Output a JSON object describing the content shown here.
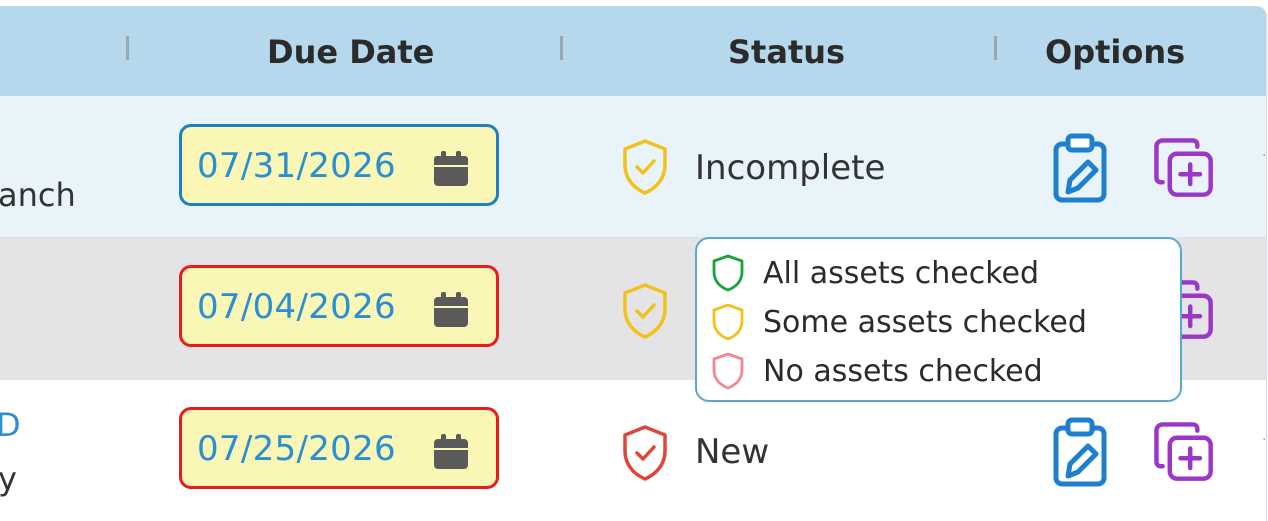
{
  "header": {
    "columns": [
      "Due Date",
      "Status",
      "Options"
    ]
  },
  "colors": {
    "header_bg": "#b5d8ec",
    "date_bg": "#faf6b6",
    "date_text": "#2a8fd1",
    "border_blue": "#1f7fc6",
    "border_red": "#e81c1c",
    "shield_green": "#1aa33a",
    "shield_yellow": "#f2c21b",
    "shield_red": "#e0453a",
    "shield_pink": "#f08a8f",
    "edit_icon": "#1c7fd0",
    "copy_icon": "#9b37c6"
  },
  "rows": [
    {
      "left_text_line2": "anch",
      "due_date": "07/31/2026",
      "date_border": "blue",
      "status_icon": "shield-check-yellow",
      "status": "Incomplete"
    },
    {
      "due_date": "07/04/2026",
      "date_border": "red",
      "status_icon": "shield-check-yellow",
      "status": ""
    },
    {
      "left_text_line1": "D",
      "left_text_line2": "y",
      "due_date": "07/25/2026",
      "date_border": "red",
      "status_icon": "shield-check-red",
      "status": "New"
    }
  ],
  "icons": {
    "calendar": "calendar-icon",
    "edit": "clipboard-edit-icon",
    "copy": "copy-add-icon"
  },
  "tooltip": {
    "items": [
      {
        "icon": "shield-green",
        "label": "All assets checked"
      },
      {
        "icon": "shield-yellow",
        "label": "Some assets checked"
      },
      {
        "icon": "shield-pink",
        "label": "No assets checked"
      }
    ]
  }
}
